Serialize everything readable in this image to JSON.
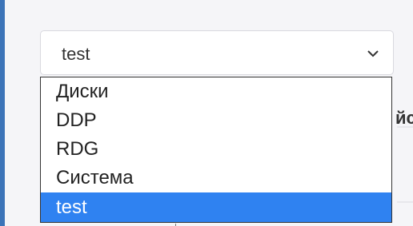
{
  "select": {
    "value": "test",
    "chevron_icon": "chevron-down-icon"
  },
  "dropdown": {
    "options": [
      {
        "label": "Диски",
        "selected": false
      },
      {
        "label": "DDP",
        "selected": false
      },
      {
        "label": "RDG",
        "selected": false
      },
      {
        "label": "Система",
        "selected": false
      },
      {
        "label": "test",
        "selected": true
      }
    ]
  },
  "background": {
    "partial_text": "йс"
  },
  "colors": {
    "accent": "#3c74b8",
    "selected_option_bg": "#2f82f1",
    "page_bg": "#f5f5f8"
  }
}
